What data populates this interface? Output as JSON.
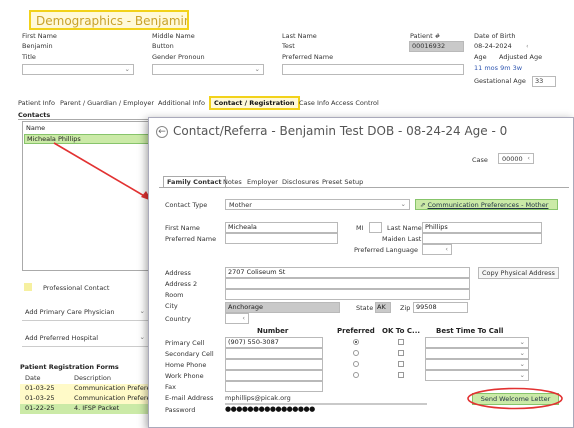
{
  "header": {
    "title": "Demographics - Benjamin Test",
    "first_name_label": "First Name",
    "first_name": "Benjamin",
    "middle_name_label": "Middle Name",
    "middle_name": "Button",
    "last_name_label": "Last Name",
    "last_name": "Test",
    "patient_num_label": "Patient #",
    "patient_num": "00016932",
    "dob_label": "Date of Birth",
    "dob": "08-24-2024",
    "title_label": "Title",
    "gender_pronoun_label": "Gender Pronoun",
    "preferred_name_label": "Preferred Name",
    "age_label": "Age",
    "adjusted_age_label": "Adjusted Age",
    "age_value": "11 mos 9m 3w",
    "gestational_age_label": "Gestational Age",
    "gestational_age": "33"
  },
  "tabs": [
    "Patient Info",
    "Parent / Guardian / Employer",
    "Additional Info",
    "Contact / Registration",
    "Case Info",
    "Access Control"
  ],
  "contacts": {
    "heading": "Contacts",
    "name_col": "Name",
    "items": [
      "Micheala Phillips"
    ],
    "professional_contact": "Professional Contact",
    "add_pcp": "Add Primary Care Physician",
    "add_hospital": "Add Preferred Hospital"
  },
  "registration": {
    "heading": "Patient Registration Forms",
    "col_date": "Date",
    "col_desc": "Description",
    "rows": [
      {
        "date": "01-03-25",
        "desc": "Communication Prefere"
      },
      {
        "date": "01-03-25",
        "desc": "Communication Prefere"
      },
      {
        "date": "01-22-25",
        "desc": "4. IFSP Packet"
      }
    ]
  },
  "modal": {
    "title": "Contact/Referra - Benjamin Test  DOB - 08-24-24  Age - 0",
    "case_label": "Case",
    "case_value": "00000",
    "tabs": [
      "Family Contact",
      "Notes",
      "Employer",
      "Disclosures",
      "Preset Setup"
    ],
    "contact_type_label": "Contact Type",
    "contact_type": "Mother",
    "comm_pref_button": "Communication Preferences - Mother",
    "first_name_label": "First Name",
    "first_name": "Micheala",
    "preferred_name_label": "Preferred Name",
    "mi_label": "MI",
    "last_name_label": "Last Name",
    "last_name": "Phillips",
    "maiden_last_label": "Maiden Last",
    "preferred_language_label": "Preferred Language",
    "address_label": "Address",
    "address": "2707 Coliseum St",
    "copy_address_button": "Copy Physical Address",
    "address2_label": "Address 2",
    "room_label": "Room",
    "city_label": "City",
    "city": "Anchorage",
    "state_label": "State",
    "state": "AK",
    "zip_label": "Zip",
    "zip": "99508",
    "country_label": "Country",
    "number_header": "Number",
    "preferred_header": "Preferred",
    "ok_header": "OK To C...",
    "best_time_header": "Best Time To Call",
    "phones": [
      {
        "label": "Primary Cell",
        "number": "(907) 550-3087"
      },
      {
        "label": "Secondary Cell",
        "number": ""
      },
      {
        "label": "Home Phone",
        "number": ""
      },
      {
        "label": "Work Phone",
        "number": ""
      }
    ],
    "fax_label": "Fax",
    "email_label": "E-mail Address",
    "email": "mphillips@picak.org",
    "password_label": "Password",
    "password": "●●●●●●●●●●●●●●●●",
    "send_welcome_button": "Send Welcome Letter"
  }
}
